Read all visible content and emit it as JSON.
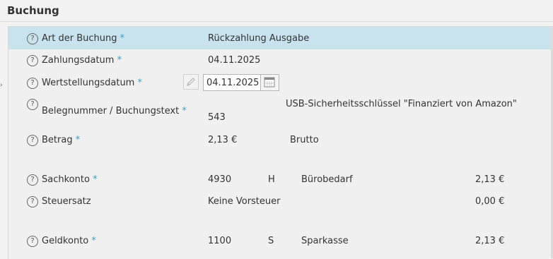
{
  "section_title": "Buchung",
  "rows": {
    "art": {
      "label": "Art der Buchung",
      "required": "*",
      "value": "Rückzahlung Ausgabe"
    },
    "zahlungsdatum": {
      "label": "Zahlungsdatum",
      "required": "*",
      "value": "04.11.2025"
    },
    "wertstellungsdatum": {
      "label": "Wertstellungsdatum",
      "required": "*",
      "value": "04.11.2025"
    },
    "beleg": {
      "label": "Belegnummer / Buchungstext",
      "required": "*",
      "number": "543",
      "text": "USB-Sicherheitsschlüssel \"Finanziert von Amazon\""
    },
    "betrag": {
      "label": "Betrag",
      "required": "*",
      "value": "2,13 €",
      "type": "Brutto"
    },
    "sachkonto": {
      "label": "Sachkonto",
      "required": "*",
      "account": "4930",
      "side": "H",
      "name": "Bürobedarf",
      "amount": "2,13 €"
    },
    "steuersatz": {
      "label": "Steuersatz",
      "value": "Keine Vorsteuer",
      "amount": "0,00 €"
    },
    "geldkonto": {
      "label": "Geldkonto",
      "required": "*",
      "account": "1100",
      "side": "S",
      "name": "Sparkasse",
      "amount": "2,13 €"
    }
  },
  "help_glyph": "?",
  "icons": [
    "help-icon",
    "pencil-icon",
    "calendar-icon"
  ],
  "colors": {
    "highlight": "#c9e3ee",
    "required_marker": "#3aa0c8"
  }
}
